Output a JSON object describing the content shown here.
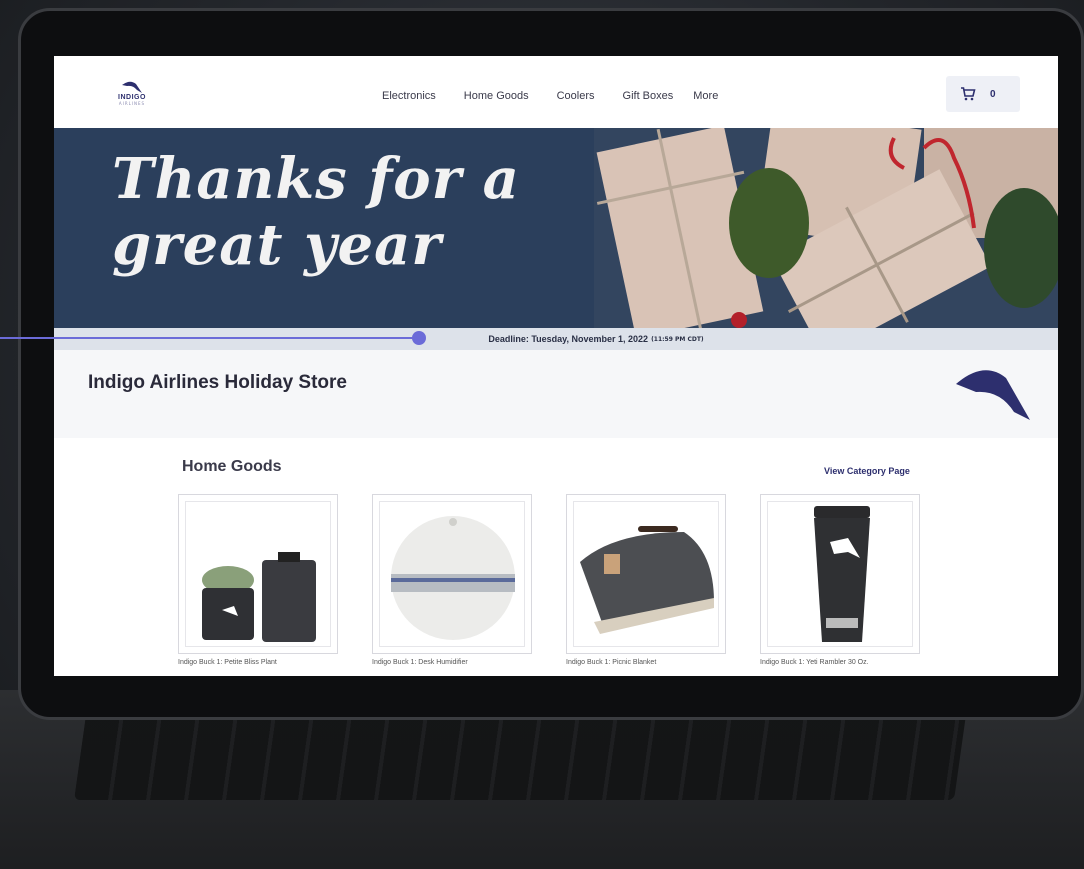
{
  "brand": {
    "logo_text": "INDIGO",
    "logo_sub": "AIRLINES"
  },
  "nav": {
    "items": [
      {
        "label": "Electronics"
      },
      {
        "label": "Home Goods"
      },
      {
        "label": "Coolers"
      },
      {
        "label": "Gift Boxes"
      },
      {
        "label": "More"
      }
    ]
  },
  "cart": {
    "icon": "cart-icon",
    "count": "0"
  },
  "hero": {
    "line1": "Thanks for a",
    "line2": "great year"
  },
  "deadline": {
    "text": "Deadline: Tuesday, November 1, 2022",
    "timezone": "(11:59 PM CDT)"
  },
  "store": {
    "title": "Indigo Airlines Holiday Store"
  },
  "section": {
    "title": "Home Goods",
    "view_link": "View Category Page",
    "products": [
      {
        "name": "Indigo Buck 1: Petite Bliss Plant"
      },
      {
        "name": "Indigo Buck 1: Desk Humidifier"
      },
      {
        "name": "Indigo Buck 1: Picnic Blanket"
      },
      {
        "name": "Indigo Buck 1: Yeti Rambler 30 Oz."
      }
    ]
  },
  "colors": {
    "brand": "#2d2f6e",
    "hero_bg": "#2b3f5c",
    "accent": "#6b6bd8"
  }
}
